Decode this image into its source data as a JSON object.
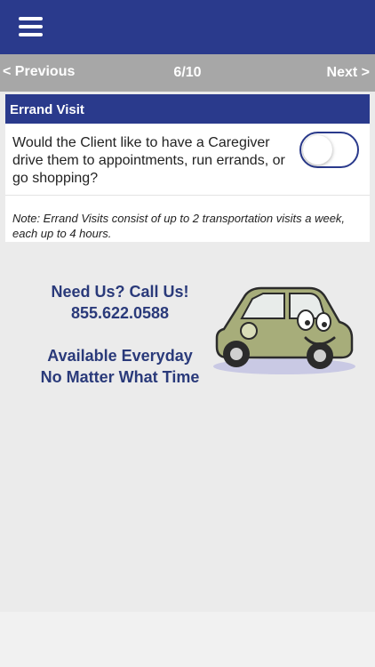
{
  "header": {
    "menu_icon": "hamburger-menu-icon"
  },
  "nav": {
    "previous_label": "< Previous",
    "page_indicator": "6/10",
    "next_label": "Next >"
  },
  "section": {
    "title": "Errand Visit",
    "question": "Would the Client like to have a Caregiver drive them to appointments, run errands, or go shopping?",
    "toggle_on": false,
    "note": "Note: Errand Visits consist of up to 2 transportation visits a week, each up to 4 hours."
  },
  "contact": {
    "headline": "Need Us? Call Us!",
    "phone": "855.622.0588",
    "availability_line1": "Available Everyday",
    "availability_line2": "No Matter What Time"
  },
  "colors": {
    "brand_blue": "#2a3a8c",
    "nav_gray": "#a7a7a7",
    "background": "#ebebeb",
    "car_green": "#a7ad7a"
  }
}
